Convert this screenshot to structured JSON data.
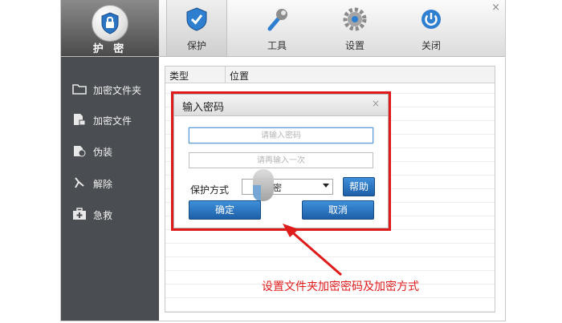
{
  "window": {
    "brand": {
      "label": "护 密",
      "icon": "lock-shield-icon"
    },
    "tabs": [
      {
        "label": "保护",
        "icon": "shield-check-icon",
        "active": true
      },
      {
        "label": "工具",
        "icon": "wrench-icon",
        "active": false
      },
      {
        "label": "设置",
        "icon": "gear-icon",
        "active": false
      },
      {
        "label": "关闭",
        "icon": "power-icon",
        "active": false
      }
    ],
    "close": "×"
  },
  "sidebar": {
    "items": [
      {
        "label": "加密文件夹",
        "icon": "folder-icon"
      },
      {
        "label": "加密文件",
        "icon": "file-lock-icon"
      },
      {
        "label": "伪装",
        "icon": "disguise-icon"
      },
      {
        "label": "解除",
        "icon": "unlock-icon"
      },
      {
        "label": "急救",
        "icon": "first-aid-kit-icon"
      }
    ]
  },
  "table": {
    "columns": [
      "类型",
      "位置"
    ]
  },
  "dialog": {
    "title": "输入密码",
    "close": "×",
    "password_placeholder": "请输入密码",
    "confirm_placeholder": "请再输入一次",
    "protect_label": "保护方式",
    "protect_value": "密",
    "help_label": "帮助",
    "ok_label": "确定",
    "cancel_label": "取消"
  },
  "annotation": {
    "text": "设置文件夹加密密码及加密方式",
    "color": "#e01b1b"
  },
  "colors": {
    "accent": "#2a72c2",
    "sidebar": "#4a4e52",
    "highlight": "#e01b1b"
  }
}
